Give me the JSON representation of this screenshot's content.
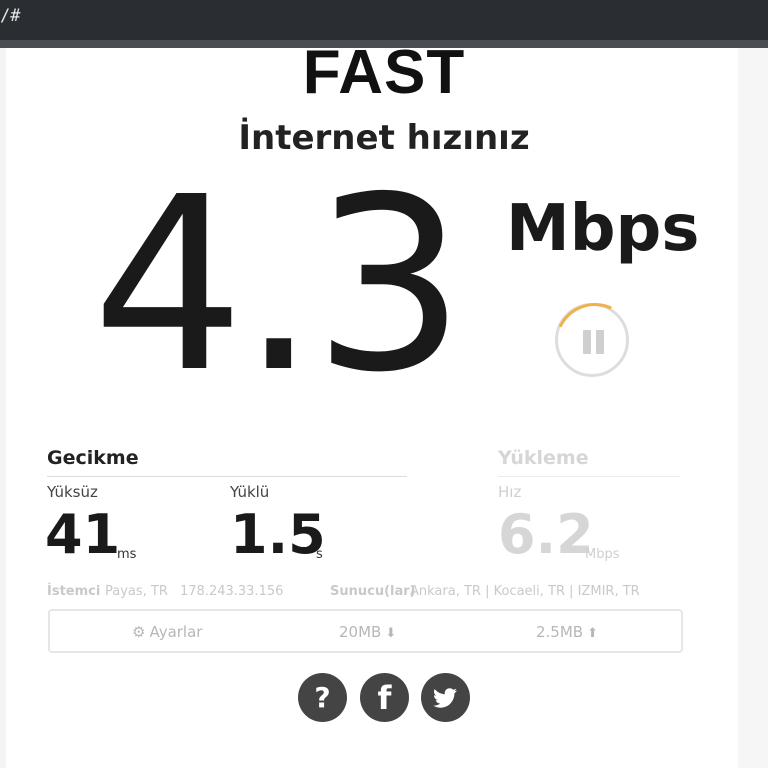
{
  "browser": {
    "url_fragment": "/#"
  },
  "brand": {
    "logo": "FAST"
  },
  "header": {
    "subtitle": "İnternet hızınız"
  },
  "speed": {
    "value": "4.3",
    "units": "Mbps"
  },
  "latency": {
    "title": "Gecikme",
    "unloaded": {
      "label": "Yüksüz",
      "value": "41",
      "unit": "ms"
    },
    "loaded": {
      "label": "Yüklü",
      "value": "1.5",
      "unit": "s"
    }
  },
  "upload": {
    "title": "Yükleme",
    "speed_label": "Hız",
    "value": "6.2",
    "unit": "Mbps"
  },
  "connection": {
    "client_label": "İstemci",
    "client_location": "Payas, TR",
    "client_ip": "178.243.33.156",
    "server_label": "Sunucu(lar)",
    "servers": "Ankara, TR  |  Kocaeli, TR  |  IZMIR, TR"
  },
  "settings": {
    "settings_label": "Ayarlar",
    "download_size": "20MB",
    "upload_size": "2.5MB"
  },
  "icons": {
    "settings": "gear-icon",
    "download_size": "download-arrow-icon",
    "upload_size": "upload-arrow-icon",
    "pause": "pause-icon",
    "help": "question-icon",
    "facebook": "facebook-icon",
    "twitter": "twitter-icon"
  },
  "colors": {
    "topbar": "#2a2e33",
    "progress_accent": "#f0b04a",
    "social_bg": "#444444"
  }
}
